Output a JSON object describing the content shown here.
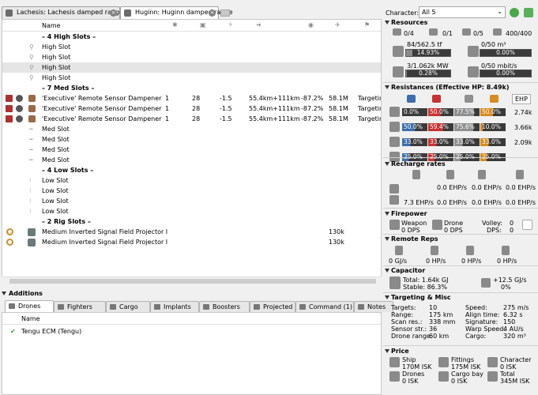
{
  "tabs": [
    {
      "label": "Lachesis: Lachesis damped range"
    },
    {
      "label": "Huginn: Huginn damped range"
    }
  ],
  "columns": {
    "name": "Name"
  },
  "slots": [
    {
      "kind": "sep",
      "name": "– 4 High Slots –"
    },
    {
      "kind": "empty",
      "name": "High Slot",
      "icon": "high-slot-icon"
    },
    {
      "kind": "empty",
      "name": "High Slot",
      "icon": "high-slot-icon"
    },
    {
      "kind": "empty",
      "name": "High Slot",
      "icon": "high-slot-icon",
      "selected": true
    },
    {
      "kind": "empty",
      "name": "High Slot",
      "icon": "high-slot-icon"
    },
    {
      "kind": "sep",
      "name": "– 7 Med Slots –"
    },
    {
      "kind": "mod",
      "name": "'Executive' Remote Sensor Dampener",
      "c1": "1",
      "c2": "28",
      "c3": "-1.5",
      "c4": "55.4km+111km",
      "c5": "-87.2%",
      "c6": "58.1M",
      "c7": "Targeting"
    },
    {
      "kind": "mod",
      "name": "'Executive' Remote Sensor Dampener",
      "c1": "1",
      "c2": "28",
      "c3": "-1.5",
      "c4": "55.4km+111km",
      "c5": "-87.2%",
      "c6": "58.1M",
      "c7": "Targeting"
    },
    {
      "kind": "mod",
      "name": "'Executive' Remote Sensor Dampener",
      "c1": "1",
      "c2": "28",
      "c3": "-1.5",
      "c4": "55.4km+111km",
      "c5": "-87.2%",
      "c6": "58.1M",
      "c7": "Targeting"
    },
    {
      "kind": "empty",
      "name": "Med Slot",
      "icon": "med-slot-icon"
    },
    {
      "kind": "empty",
      "name": "Med Slot",
      "icon": "med-slot-icon"
    },
    {
      "kind": "empty",
      "name": "Med Slot",
      "icon": "med-slot-icon"
    },
    {
      "kind": "empty",
      "name": "Med Slot",
      "icon": "med-slot-icon"
    },
    {
      "kind": "sep",
      "name": "– 4 Low Slots –"
    },
    {
      "kind": "empty",
      "name": "Low Slot",
      "icon": "low-slot-icon"
    },
    {
      "kind": "empty",
      "name": "Low Slot",
      "icon": "low-slot-icon"
    },
    {
      "kind": "empty",
      "name": "Low Slot",
      "icon": "low-slot-icon"
    },
    {
      "kind": "empty",
      "name": "Low Slot",
      "icon": "low-slot-icon"
    },
    {
      "kind": "sep",
      "name": "– 2 Rig Slots –"
    },
    {
      "kind": "rig",
      "name": "Medium Inverted Signal Field Projector I",
      "c6": "130k"
    },
    {
      "kind": "rig",
      "name": "Medium Inverted Signal Field Projector I",
      "c6": "130k"
    }
  ],
  "additions": {
    "title": "Additions",
    "tabs": [
      "Drones",
      "Fighters",
      "Cargo",
      "Implants",
      "Boosters",
      "Projected",
      "Command (1)",
      "Notes"
    ],
    "name_header": "Name",
    "items": [
      {
        "name": "Tengu ECM (Tengu)"
      }
    ]
  },
  "character": {
    "label": "Character:",
    "value": "All 5"
  },
  "resources": {
    "title": "Resources",
    "hardpoints": [
      "0/4",
      "0/1",
      "0/5",
      "400/400"
    ],
    "cpu": {
      "text": "84/562.5 tf",
      "bar": "14.93%",
      "pct": 0.1493
    },
    "drone_bay": {
      "text": "0/50 m³",
      "bar": "0.00%"
    },
    "pg": {
      "text": "3/1.062k MW",
      "bar": "0.28%",
      "pct": 0.0028
    },
    "bandwidth": {
      "text": "0/50 mbit/s",
      "bar": "0.00%"
    }
  },
  "resistances": {
    "title": "Resistances (Effective HP: 8.49k)",
    "ehp_button": "EHP",
    "rows": [
      {
        "v": [
          "0.0%",
          "50.0%",
          "77.5%",
          "50.0%"
        ],
        "hp": "2.74k"
      },
      {
        "v": [
          "50.0%",
          "59.4%",
          "75.6%",
          "10.0%"
        ],
        "hp": "3.66k"
      },
      {
        "v": [
          "33.0%",
          "33.0%",
          "33.0%",
          "33.0%"
        ],
        "hp": "2.09k"
      },
      {
        "v": [
          "25.0%",
          "25.0%",
          "25.0%",
          "25.0%"
        ],
        "hp": ""
      }
    ]
  },
  "recharge": {
    "title": "Recharge rates",
    "row1": [
      "0.0 EHP/s",
      "0.0 EHP/s",
      "0.0 EHP/s"
    ],
    "row2": [
      "7.3 EHP/s",
      "0.0 EHP/s",
      "0.0 EHP/s",
      "0.0 EHP/s"
    ]
  },
  "firepower": {
    "title": "Firepower",
    "weapon_label": "Weapon",
    "weapon_val": "0 DPS",
    "drone_label": "Drone",
    "drone_val": "0 DPS",
    "volley_label": "Volley:",
    "volley_val": "0",
    "dps_label": "DPS:",
    "dps_val": "0"
  },
  "remote_reps": {
    "title": "Remote Reps",
    "values": [
      "0 GJ/s",
      "0 HP/s",
      "0 HP/s",
      "0 HP/s"
    ]
  },
  "capacitor": {
    "title": "Capacitor",
    "total": "Total: 1.64k GJ",
    "stable": "Stable: 86.3%",
    "delta": "+12.5 GJ/s",
    "delta_pct": "0%"
  },
  "targeting": {
    "title": "Targeting & Misc",
    "left": [
      [
        "Targets:",
        "10"
      ],
      [
        "Range:",
        "175 km"
      ],
      [
        "Scan res.:",
        "338 mm"
      ],
      [
        "Sensor str.:",
        "36"
      ],
      [
        "Drone range:",
        "60 km"
      ]
    ],
    "right": [
      [
        "Speed:",
        "275 m/s"
      ],
      [
        "Align time:",
        "6.32 s"
      ],
      [
        "Signature:",
        "150"
      ],
      [
        "Warp Speed:",
        "4 AU/s"
      ],
      [
        "Cargo:",
        "320 m³"
      ]
    ]
  },
  "price": {
    "title": "Price",
    "items": [
      [
        "Ship",
        "170M ISK"
      ],
      [
        "Fittings",
        "175M ISK"
      ],
      [
        "Character",
        "0 ISK"
      ],
      [
        "Drones",
        "0 ISK"
      ],
      [
        "Cargo bay",
        "0 ISK"
      ],
      [
        "Total",
        "345M ISK"
      ]
    ]
  },
  "colors": {
    "em": "#3d6fae",
    "thermal": "#c83232",
    "kinetic": "#8f8f8f",
    "explosive": "#d88c1e",
    "bar": "#6b6b6b"
  }
}
